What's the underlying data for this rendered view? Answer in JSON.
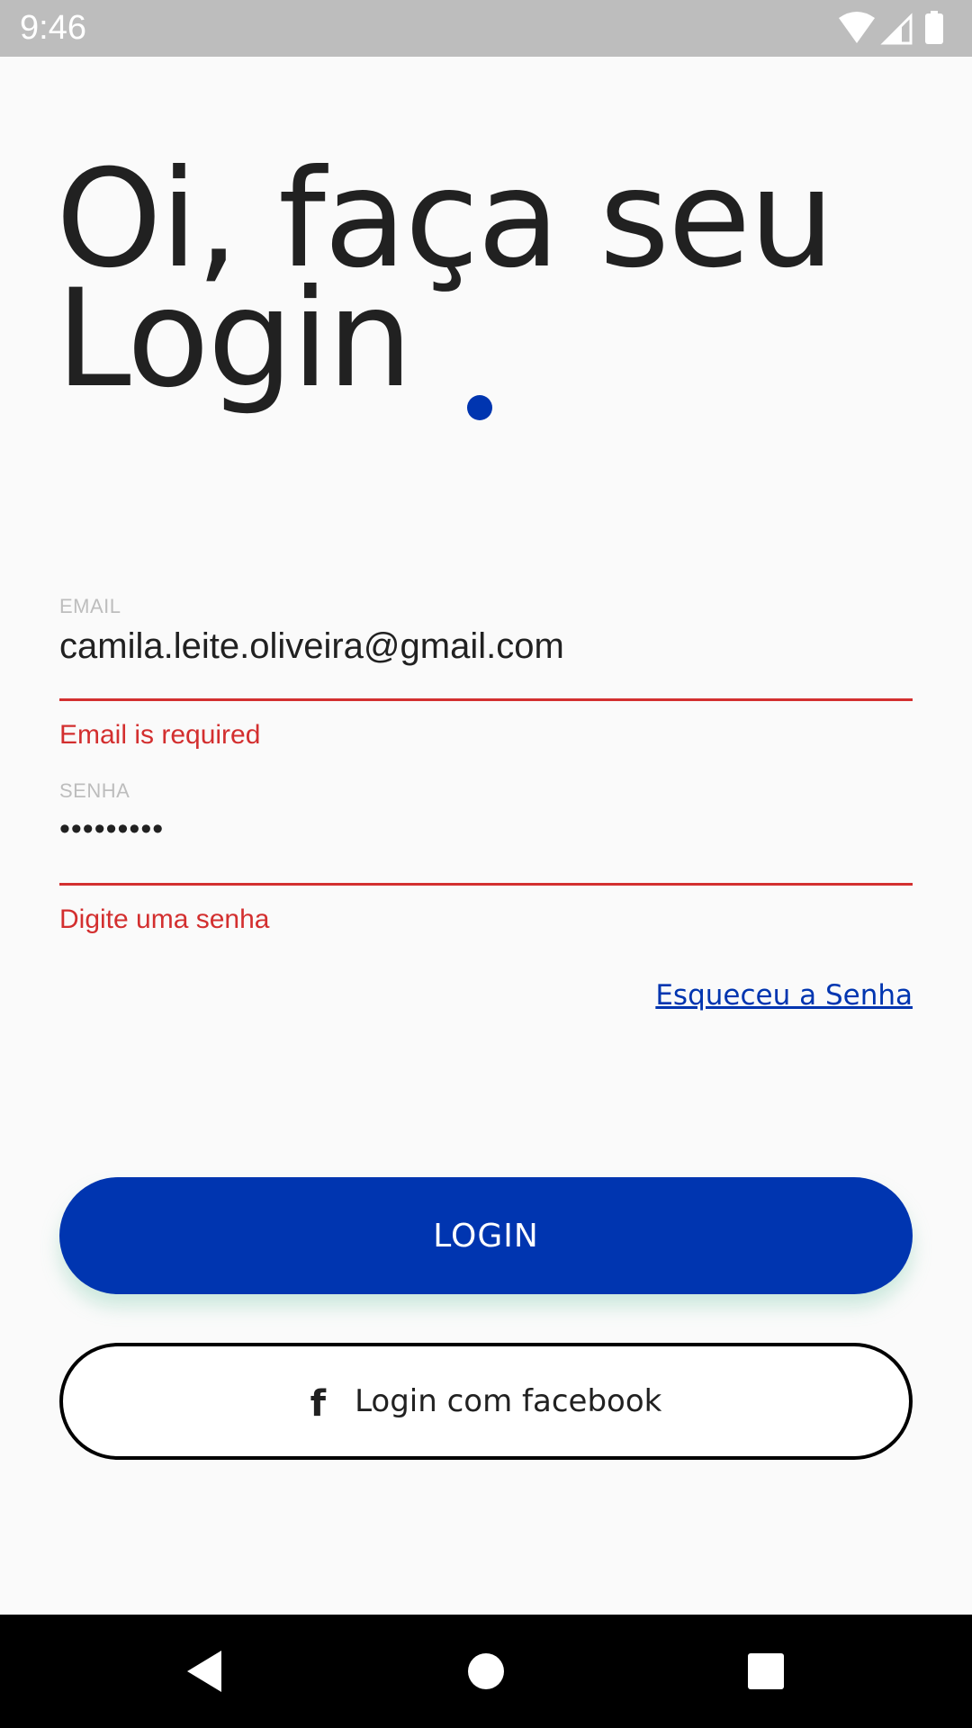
{
  "status_bar": {
    "time": "9:46"
  },
  "login": {
    "title_line1": "Oi, faça seu",
    "title_line2": "Login",
    "email": {
      "label": "EMAIL",
      "value": "camila.leite.oliveira@gmail.com",
      "error": "Email is required"
    },
    "password": {
      "label": "SENHA",
      "value": "•••••••••",
      "error": "Digite uma senha"
    },
    "forgot_password": "Esqueceu a Senha",
    "login_button": "LOGIN",
    "facebook_button": "Login com facebook"
  },
  "colors": {
    "accent": "#0035b0",
    "error": "#d32f2f",
    "text": "#212121",
    "label": "#bdbdbd"
  },
  "icons": {
    "facebook": "f",
    "nav_back": "back-triangle",
    "nav_home": "home-circle",
    "nav_recents": "recents-square"
  }
}
